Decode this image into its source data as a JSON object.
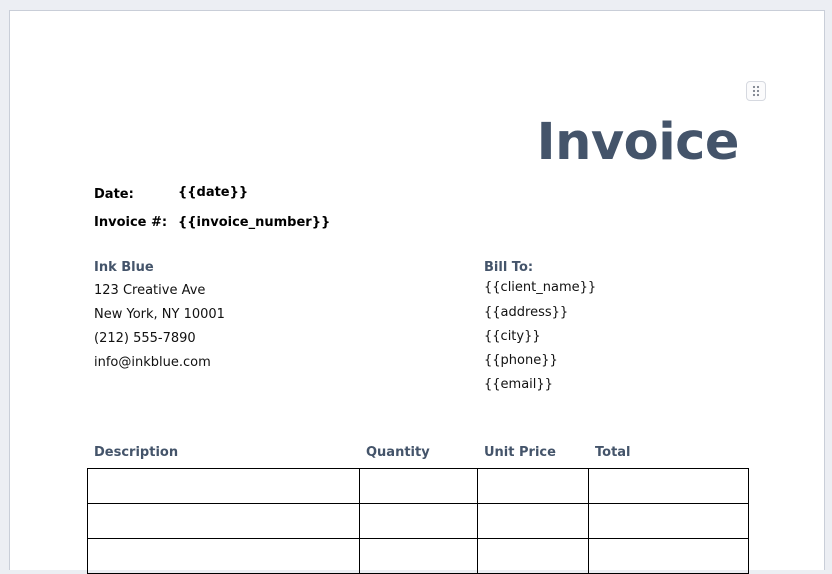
{
  "invoice": {
    "title": "Invoice",
    "date_label": "Date:",
    "date_value": "{{date}}",
    "number_label": "Invoice #:",
    "number_value": "{{invoice_number}}"
  },
  "sender": {
    "name": "Ink Blue",
    "lines": [
      "123 Creative Ave",
      "New York, NY 10001",
      "(212) 555-7890",
      "info@inkblue.com"
    ]
  },
  "bill_to": {
    "heading": "Bill To:",
    "lines": [
      "{{client_name}}",
      "{{address}}",
      "{{city}}",
      "{{phone}}",
      "{{email}}"
    ]
  },
  "items_table": {
    "columns": [
      "Description",
      "Quantity",
      "Unit Price",
      "Total"
    ],
    "rows": [
      [
        "",
        "",
        "",
        ""
      ],
      [
        "",
        "",
        "",
        ""
      ],
      [
        "",
        "",
        "",
        ""
      ]
    ]
  },
  "icons": {
    "drag_handle": "drag-handle-icon"
  },
  "colors": {
    "heading": "#44546a",
    "text": "#000000",
    "border": "#000000"
  }
}
